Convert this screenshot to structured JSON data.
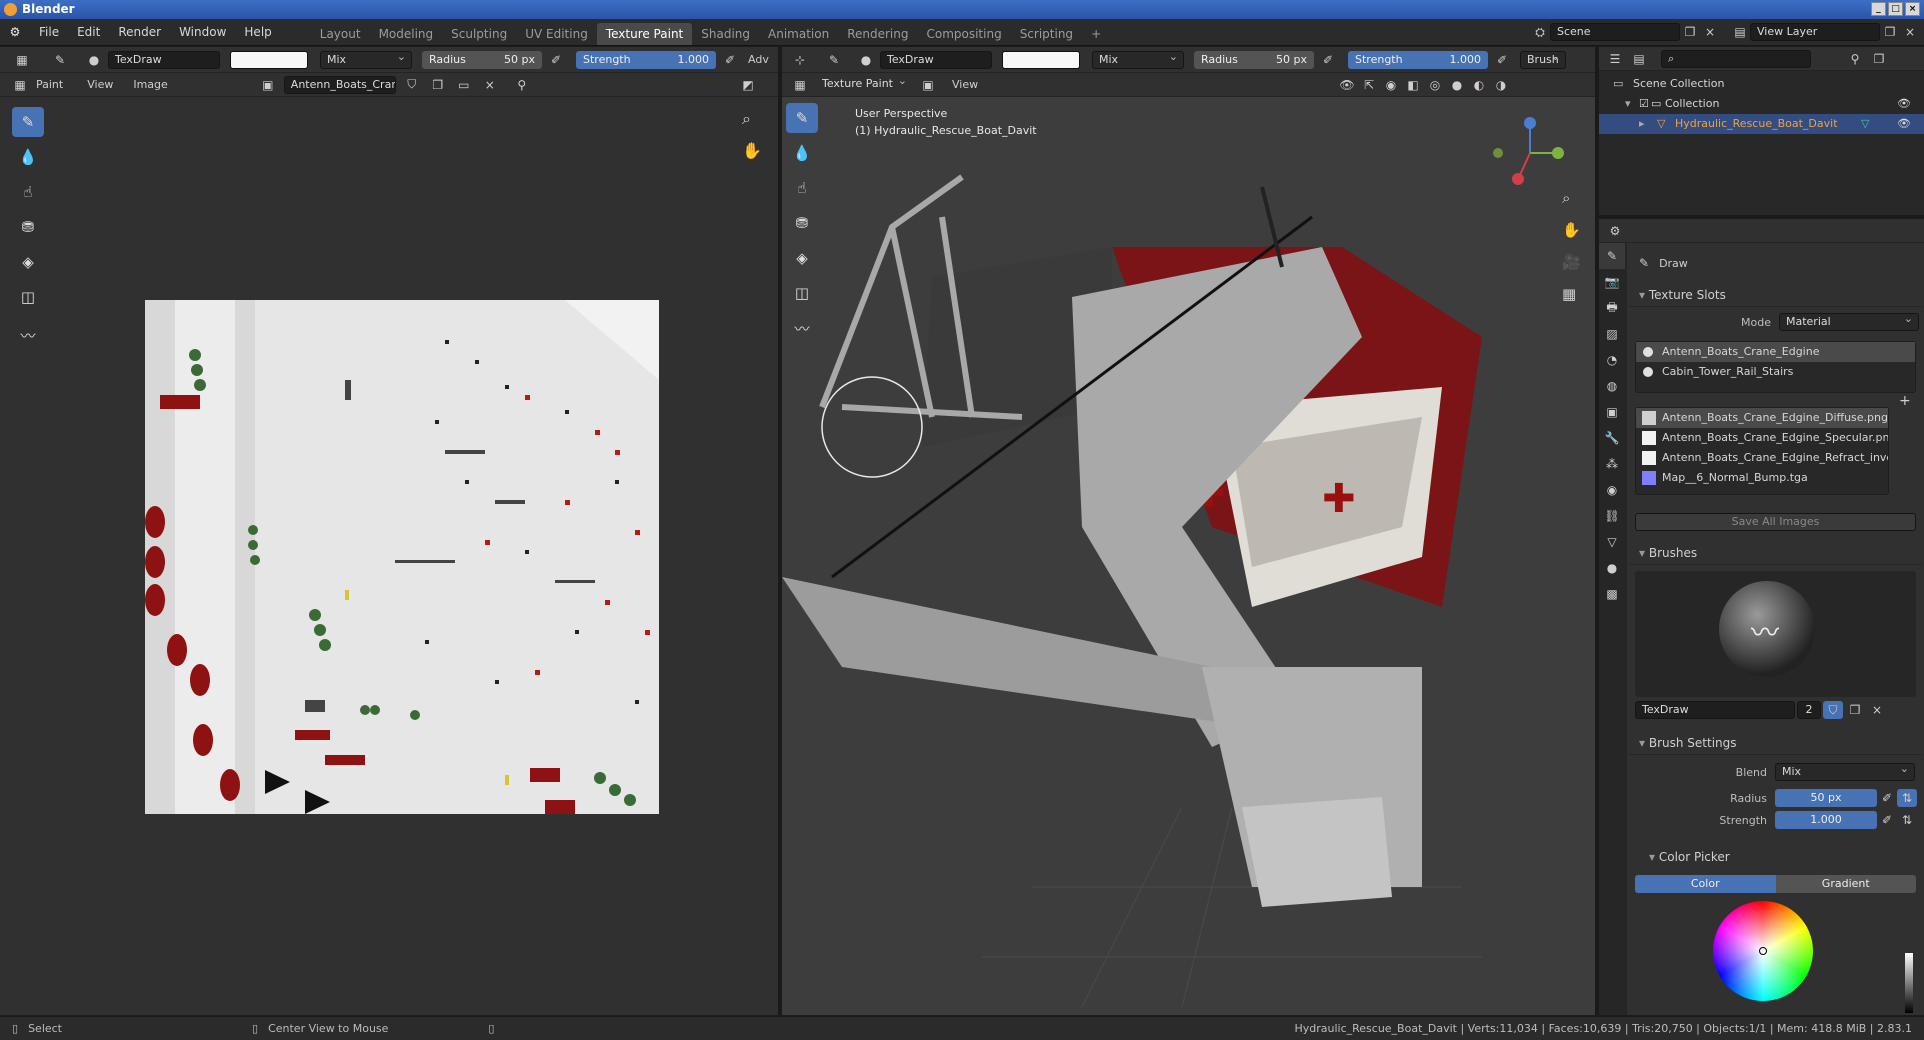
{
  "app": {
    "title": "Blender"
  },
  "menu": {
    "items": [
      "File",
      "Edit",
      "Render",
      "Window",
      "Help"
    ]
  },
  "workspaces": {
    "tabs": [
      "Layout",
      "Modeling",
      "Sculpting",
      "UV Editing",
      "Texture Paint",
      "Shading",
      "Animation",
      "Rendering",
      "Compositing",
      "Scripting"
    ],
    "active": "Texture Paint",
    "add": "+"
  },
  "scene": {
    "name": "Scene",
    "view_layer": "View Layer"
  },
  "left_header": {
    "brush": "TexDraw",
    "blend": "Mix",
    "radius_label": "Radius",
    "radius_value": "50 px",
    "strength_label": "Strength",
    "strength_value": "1.000",
    "advanced": "Adv"
  },
  "left_subheader": {
    "mode": "Paint",
    "view": "View",
    "image": "Image",
    "image_name": "Antenn_Boats_Cran..."
  },
  "right_header": {
    "brush": "TexDraw",
    "blend": "Mix",
    "radius_label": "Radius",
    "radius_value": "50 px",
    "strength_label": "Strength",
    "strength_value": "1.000",
    "brush_menu": "Brush"
  },
  "viewport_subheader": {
    "mode": "Texture Paint",
    "view": "View"
  },
  "viewport": {
    "perspective": "User Perspective",
    "object": "(1) Hydraulic_Rescue_Boat_Davit"
  },
  "outliner": {
    "scene_collection": "Scene Collection",
    "collection": "Collection",
    "object": "Hydraulic_Rescue_Boat_Davit"
  },
  "properties": {
    "tool_name": "Draw",
    "texture_slots": {
      "title": "Texture Slots",
      "mode_label": "Mode",
      "mode_value": "Material",
      "materials": [
        "Antenn_Boats_Crane_Edgine",
        "Cabin_Tower_Rail_Stairs"
      ],
      "images": [
        "Antenn_Boats_Crane_Edgine_Diffuse.png",
        "Antenn_Boats_Crane_Edgine_Specular.png",
        "Antenn_Boats_Crane_Edgine_Refract_inver...",
        "Map__6_Normal_Bump.tga"
      ],
      "save_all": "Save All Images"
    },
    "brushes": {
      "title": "Brushes",
      "brush_name": "TexDraw",
      "users": "2"
    },
    "brush_settings": {
      "title": "Brush Settings",
      "blend_label": "Blend",
      "blend_value": "Mix",
      "radius_label": "Radius",
      "radius_value": "50 px",
      "strength_label": "Strength",
      "strength_value": "1.000"
    },
    "color_picker": {
      "title": "Color Picker",
      "tab_color": "Color",
      "tab_gradient": "Gradient"
    }
  },
  "status": {
    "select": "Select",
    "center_view": "Center View to Mouse",
    "stats": "Hydraulic_Rescue_Boat_Davit | Verts:11,034 | Faces:10,639 | Tris:20,750 | Objects:1/1 | Mem: 418.8 MiB | 2.83.1"
  }
}
